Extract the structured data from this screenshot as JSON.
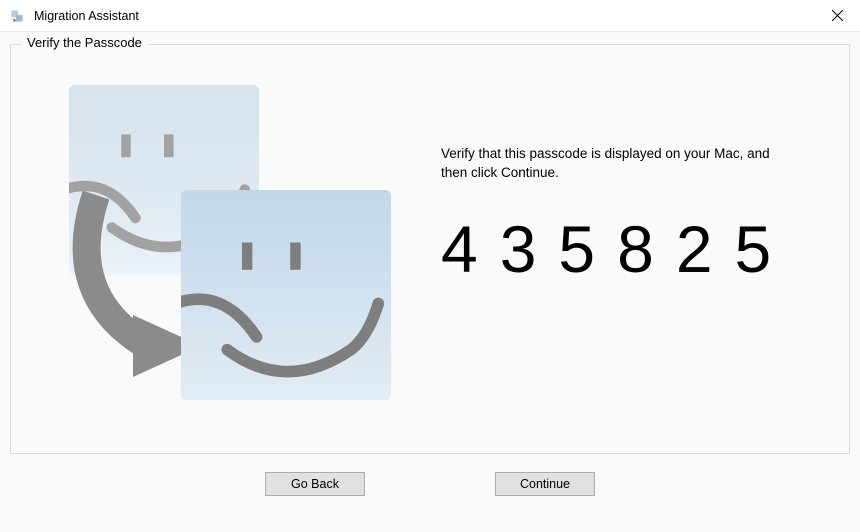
{
  "window": {
    "title": "Migration Assistant"
  },
  "section": {
    "legend": "Verify the Passcode",
    "instruction": "Verify that this passcode is displayed on your Mac, and then click Continue.",
    "passcode": "435825"
  },
  "buttons": {
    "back": "Go Back",
    "continue": "Continue"
  },
  "colors": {
    "accent": "#0078d7"
  }
}
